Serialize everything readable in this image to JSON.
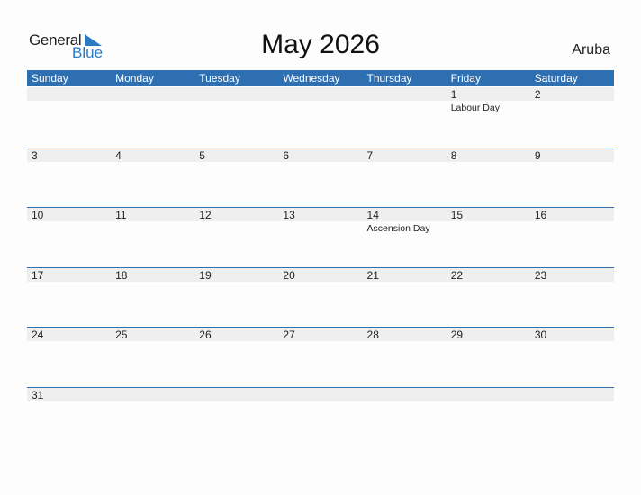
{
  "logo": {
    "general": "General",
    "blue": "Blue"
  },
  "title": "May 2026",
  "country": "Aruba",
  "colors": {
    "accent": "#2e6fb1",
    "band": "#efefef",
    "logo_blue": "#2a7bc4"
  },
  "weekdays": [
    "Sunday",
    "Monday",
    "Tuesday",
    "Wednesday",
    "Thursday",
    "Friday",
    "Saturday"
  ],
  "weeks": [
    [
      {
        "day": ""
      },
      {
        "day": ""
      },
      {
        "day": ""
      },
      {
        "day": ""
      },
      {
        "day": ""
      },
      {
        "day": "1",
        "holiday": "Labour Day"
      },
      {
        "day": "2"
      }
    ],
    [
      {
        "day": "3"
      },
      {
        "day": "4"
      },
      {
        "day": "5"
      },
      {
        "day": "6"
      },
      {
        "day": "7"
      },
      {
        "day": "8"
      },
      {
        "day": "9"
      }
    ],
    [
      {
        "day": "10"
      },
      {
        "day": "11"
      },
      {
        "day": "12"
      },
      {
        "day": "13"
      },
      {
        "day": "14",
        "holiday": "Ascension Day"
      },
      {
        "day": "15"
      },
      {
        "day": "16"
      }
    ],
    [
      {
        "day": "17"
      },
      {
        "day": "18"
      },
      {
        "day": "19"
      },
      {
        "day": "20"
      },
      {
        "day": "21"
      },
      {
        "day": "22"
      },
      {
        "day": "23"
      }
    ],
    [
      {
        "day": "24"
      },
      {
        "day": "25"
      },
      {
        "day": "26"
      },
      {
        "day": "27"
      },
      {
        "day": "28"
      },
      {
        "day": "29"
      },
      {
        "day": "30"
      }
    ],
    [
      {
        "day": "31"
      },
      {
        "day": ""
      },
      {
        "day": ""
      },
      {
        "day": ""
      },
      {
        "day": ""
      },
      {
        "day": ""
      },
      {
        "day": ""
      }
    ]
  ]
}
